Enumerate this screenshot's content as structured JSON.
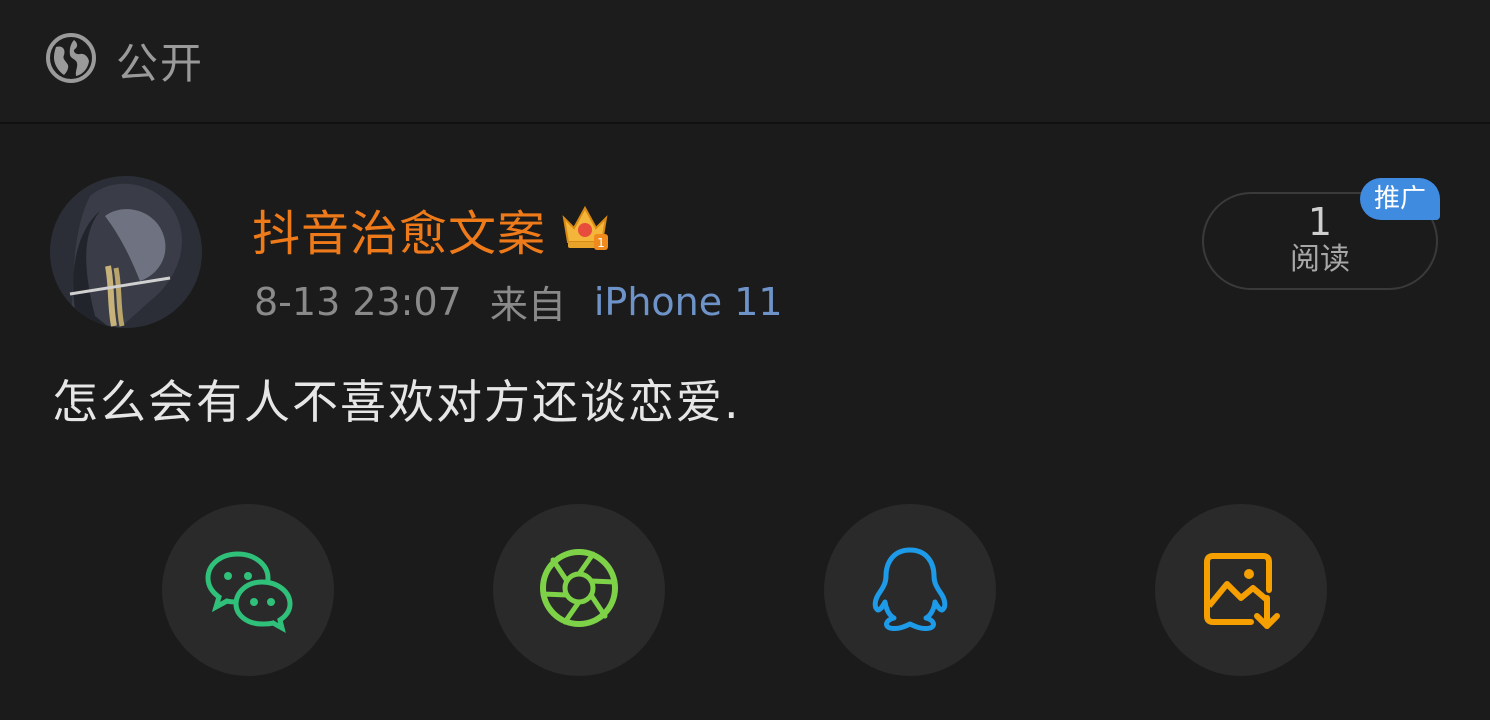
{
  "header": {
    "visibility_label": "公开",
    "visibility_icon": "globe-icon"
  },
  "post": {
    "author": "抖音治愈文案",
    "badge_icon": "crown-icon",
    "timestamp": "8-13 23:07",
    "from_label": "来自",
    "device": "iPhone 11",
    "text": "怎么会有人不喜欢对方还谈恋爱.",
    "read_count": "1",
    "read_label": "阅读",
    "promo_label": "推广",
    "colors": {
      "author": "#ef7a1a",
      "device": "#6e93c8",
      "promo": "#3f8be0"
    }
  },
  "share": {
    "items": [
      {
        "name": "wechat",
        "icon": "wechat-icon",
        "color": "#2fc07a"
      },
      {
        "name": "moments",
        "icon": "moments-icon",
        "color": "#7ed247"
      },
      {
        "name": "qq",
        "icon": "qq-icon",
        "color": "#1e9be8"
      },
      {
        "name": "save-image",
        "icon": "save-image-icon",
        "color": "#f5a000"
      }
    ]
  }
}
